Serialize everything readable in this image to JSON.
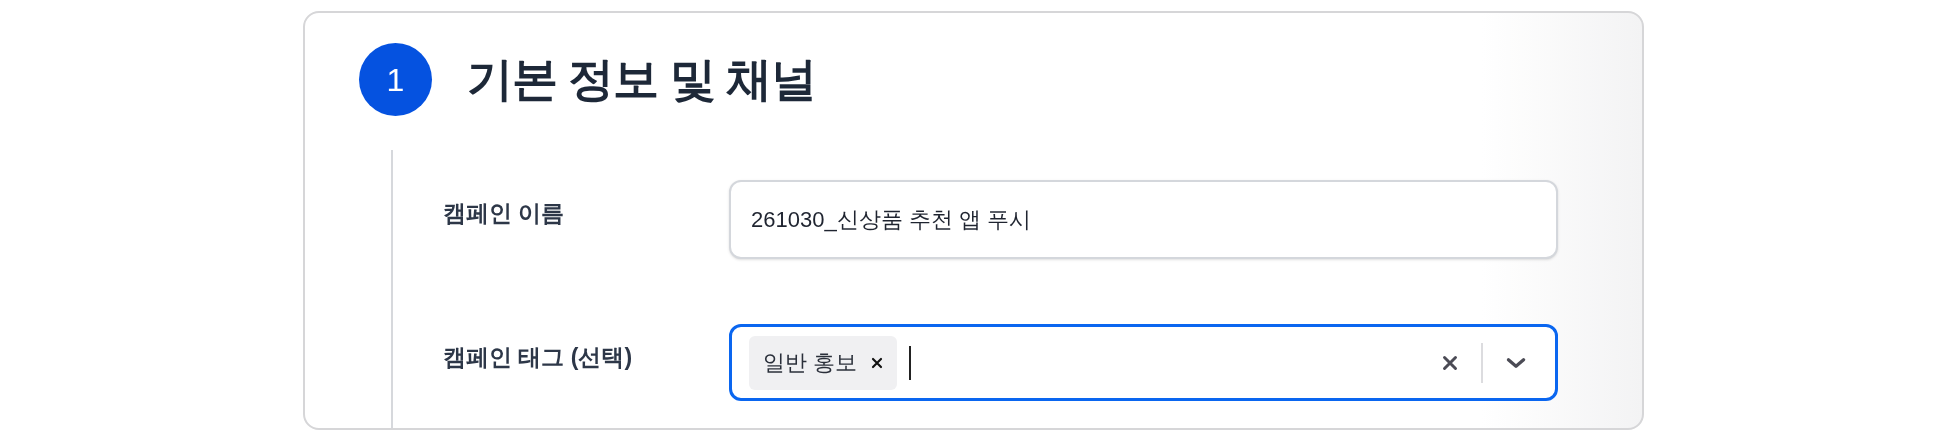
{
  "section": {
    "number": "1",
    "title": "기본 정보 및 채널"
  },
  "fields": [
    {
      "kind": "text",
      "label": "캠페인 이름",
      "value": "261030_신상품 추천 앱 푸시",
      "focused": false
    },
    {
      "kind": "tags",
      "label": "캠페인 태그 (선택)",
      "tags": [
        "일반 홍보"
      ],
      "focused": true
    }
  ]
}
